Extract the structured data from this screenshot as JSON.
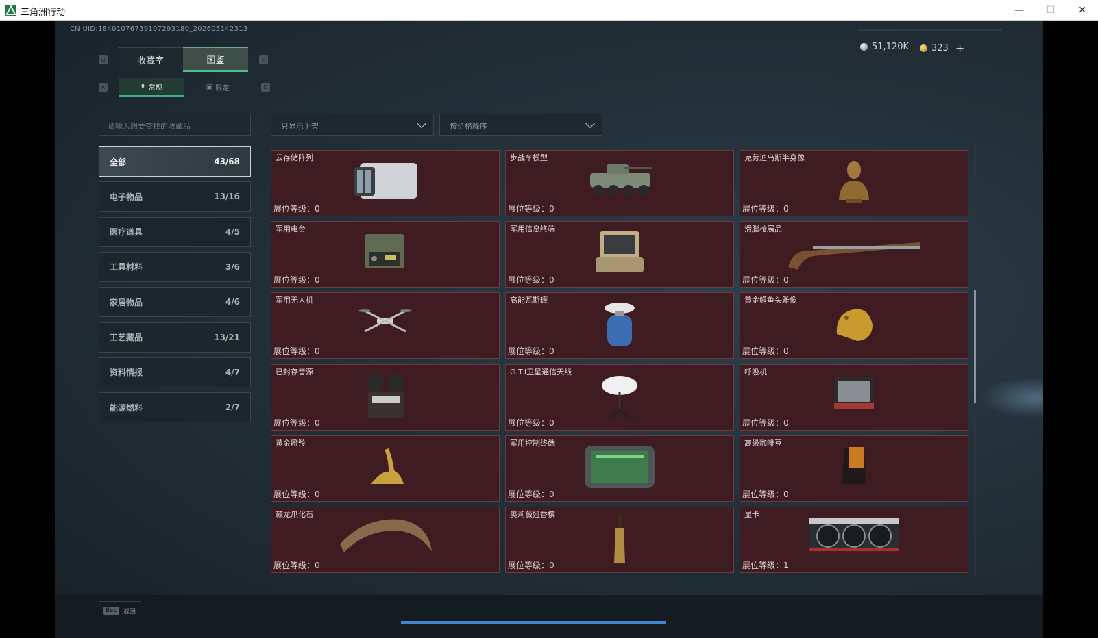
{
  "window": {
    "title": "三角洲行动",
    "min": "—",
    "max": "☐",
    "close": "✕"
  },
  "header": {
    "uid": "CN UID:18401076739107293180_202605142313",
    "currency_silver": "51,120K",
    "currency_gold": "323",
    "currency_plus": "+"
  },
  "tabs": {
    "key_prev": "Q",
    "key_next": "E",
    "collection_room": "收藏室",
    "catalog": "图鉴",
    "sub_key_prev": "A",
    "sub_key_next": "D",
    "normal": "常规",
    "limited": "限定"
  },
  "filters": {
    "search_placeholder": "请输入想要查找的收藏品",
    "listing_filter": "只显示上架",
    "sort": "按价格降序"
  },
  "categories": [
    {
      "label": "全部",
      "count": "43/68",
      "active": true
    },
    {
      "label": "电子物品",
      "count": "13/16"
    },
    {
      "label": "医疗道具",
      "count": "4/5"
    },
    {
      "label": "工具材料",
      "count": "3/6"
    },
    {
      "label": "家居物品",
      "count": "4/6"
    },
    {
      "label": "工艺藏品",
      "count": "13/21"
    },
    {
      "label": "资料情报",
      "count": "4/7"
    },
    {
      "label": "能源燃料",
      "count": "2/7"
    }
  ],
  "level_label": "展位等级：",
  "items": [
    {
      "name": "云存储阵列",
      "level": "0",
      "icon": "server-array-icon"
    },
    {
      "name": "步战车模型",
      "level": "0",
      "icon": "ifv-model-icon"
    },
    {
      "name": "克劳迪乌斯半身像",
      "level": "0",
      "icon": "bust-statue-icon"
    },
    {
      "name": "军用电台",
      "level": "0",
      "icon": "military-radio-icon"
    },
    {
      "name": "军用信息终端",
      "level": "0",
      "icon": "rugged-terminal-icon"
    },
    {
      "name": "滑膛枪展品",
      "level": "0",
      "icon": "musket-icon"
    },
    {
      "name": "军用无人机",
      "level": "0",
      "icon": "drone-icon"
    },
    {
      "name": "高能瓦斯罐",
      "level": "0",
      "icon": "gas-canister-icon"
    },
    {
      "name": "黄金鳄鱼头雕像",
      "level": "0",
      "icon": "gold-crocodile-icon"
    },
    {
      "name": "已封存音源",
      "level": "0",
      "icon": "reel-recorder-icon"
    },
    {
      "name": "G.T.I卫星通信天线",
      "level": "0",
      "icon": "satellite-dish-icon"
    },
    {
      "name": "呼吸机",
      "level": "0",
      "icon": "ventilator-icon"
    },
    {
      "name": "黄金瞪羚",
      "level": "0",
      "icon": "gold-gazelle-icon"
    },
    {
      "name": "军用控制终端",
      "level": "0",
      "icon": "control-tablet-icon"
    },
    {
      "name": "高级咖啡豆",
      "level": "0",
      "icon": "coffee-bag-icon"
    },
    {
      "name": "棘龙爪化石",
      "level": "0",
      "icon": "claw-fossil-icon"
    },
    {
      "name": "奥莉薇娅香槟",
      "level": "0",
      "icon": "champagne-icon"
    },
    {
      "name": "显卡",
      "level": "1",
      "icon": "graphics-card-icon"
    }
  ],
  "footer": {
    "esc_key": "Esc",
    "esc_label": "返回"
  },
  "colors": {
    "card_bg": "#3f1c21",
    "accent_green": "#47c48a",
    "progress_blue": "#3e86d4"
  }
}
